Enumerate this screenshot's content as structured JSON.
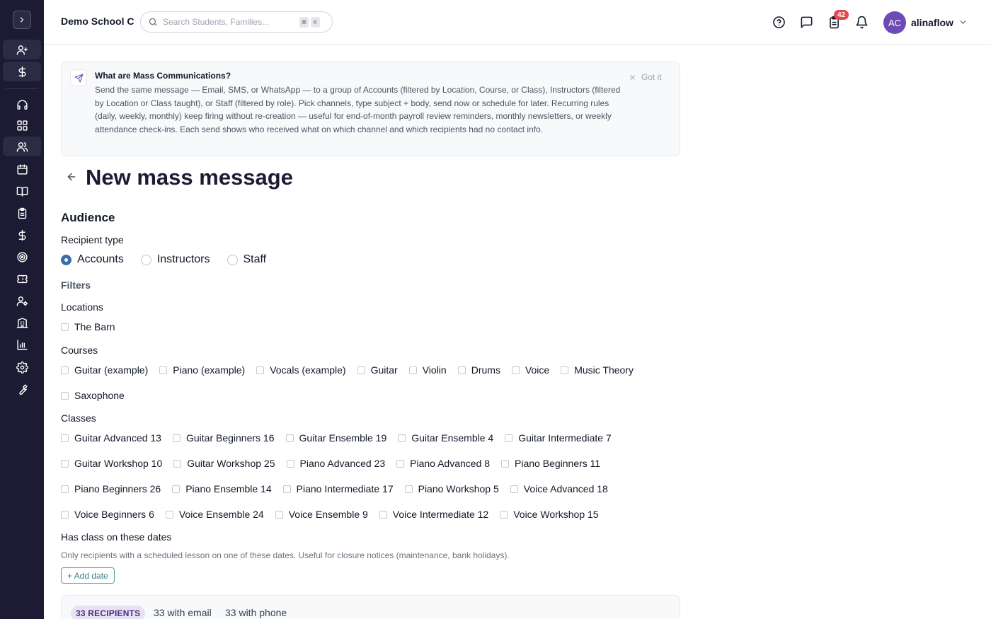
{
  "topbar": {
    "school_name": "Demo School C",
    "search_placeholder": "Search Students, Families...",
    "shortcut_key_1": "⌘",
    "shortcut_key_2": "K",
    "tasks_badge": "42",
    "avatar_initials": "AC",
    "username": "alinaflow"
  },
  "banner": {
    "title": "What are Mass Communications?",
    "body": "Send the same message — Email, SMS, or WhatsApp — to a group of Accounts (filtered by Location, Course, or Class), Instructors (filtered by Location or Class taught), or Staff (filtered by role). Pick channels, type subject + body, send now or schedule for later. Recurring rules (daily, weekly, monthly) keep firing without re-creation — useful for end-of-month payroll review reminders, monthly newsletters, or weekly attendance check-ins. Each send shows who received what on which channel and which recipients had no contact info.",
    "dismiss_label": "Got it"
  },
  "page": {
    "title": "New mass message"
  },
  "audience": {
    "section_title": "Audience",
    "recipient_type_label": "Recipient type",
    "recipient_types": [
      {
        "label": "Accounts",
        "selected": true
      },
      {
        "label": "Instructors",
        "selected": false
      },
      {
        "label": "Staff",
        "selected": false
      }
    ],
    "filters_label": "Filters",
    "locations_label": "Locations",
    "locations": [
      "The Barn"
    ],
    "courses_label": "Courses",
    "courses_row1": [
      "Guitar (example)",
      "Piano (example)",
      "Vocals (example)",
      "Guitar",
      "Violin",
      "Drums",
      "Voice",
      "Music Theory"
    ],
    "courses_row2": [
      "Saxophone"
    ],
    "classes_label": "Classes",
    "classes_rows": [
      [
        "Guitar Advanced 13",
        "Guitar Beginners 16",
        "Guitar Ensemble 19",
        "Guitar Ensemble 4",
        "Guitar Intermediate 7"
      ],
      [
        "Guitar Workshop 10",
        "Guitar Workshop 25",
        "Piano Advanced 23",
        "Piano Advanced 8",
        "Piano Beginners 11"
      ],
      [
        "Piano Beginners 26",
        "Piano Ensemble 14",
        "Piano Intermediate 17",
        "Piano Workshop 5",
        "Voice Advanced 18"
      ],
      [
        "Voice Beginners 6",
        "Voice Ensemble 24",
        "Voice Ensemble 9",
        "Voice Intermediate 12",
        "Voice Workshop 15"
      ]
    ],
    "dates_label": "Has class on these dates",
    "dates_hint": "Only recipients with a scheduled lesson on one of these dates. Useful for closure notices (maintenance, bank holidays).",
    "add_date_label": "+ Add date"
  },
  "summary": {
    "recipients_pill": "33 RECIPIENTS",
    "with_email": "33 with email",
    "with_phone": "33 with phone"
  },
  "colors": {
    "sidebar_bg": "#1c1b33",
    "accent_radio": "#3b6ea8",
    "badge_red": "#e5484d",
    "avatar_purple": "#6d4bb5",
    "add_date_teal": "#3b7f8a"
  }
}
